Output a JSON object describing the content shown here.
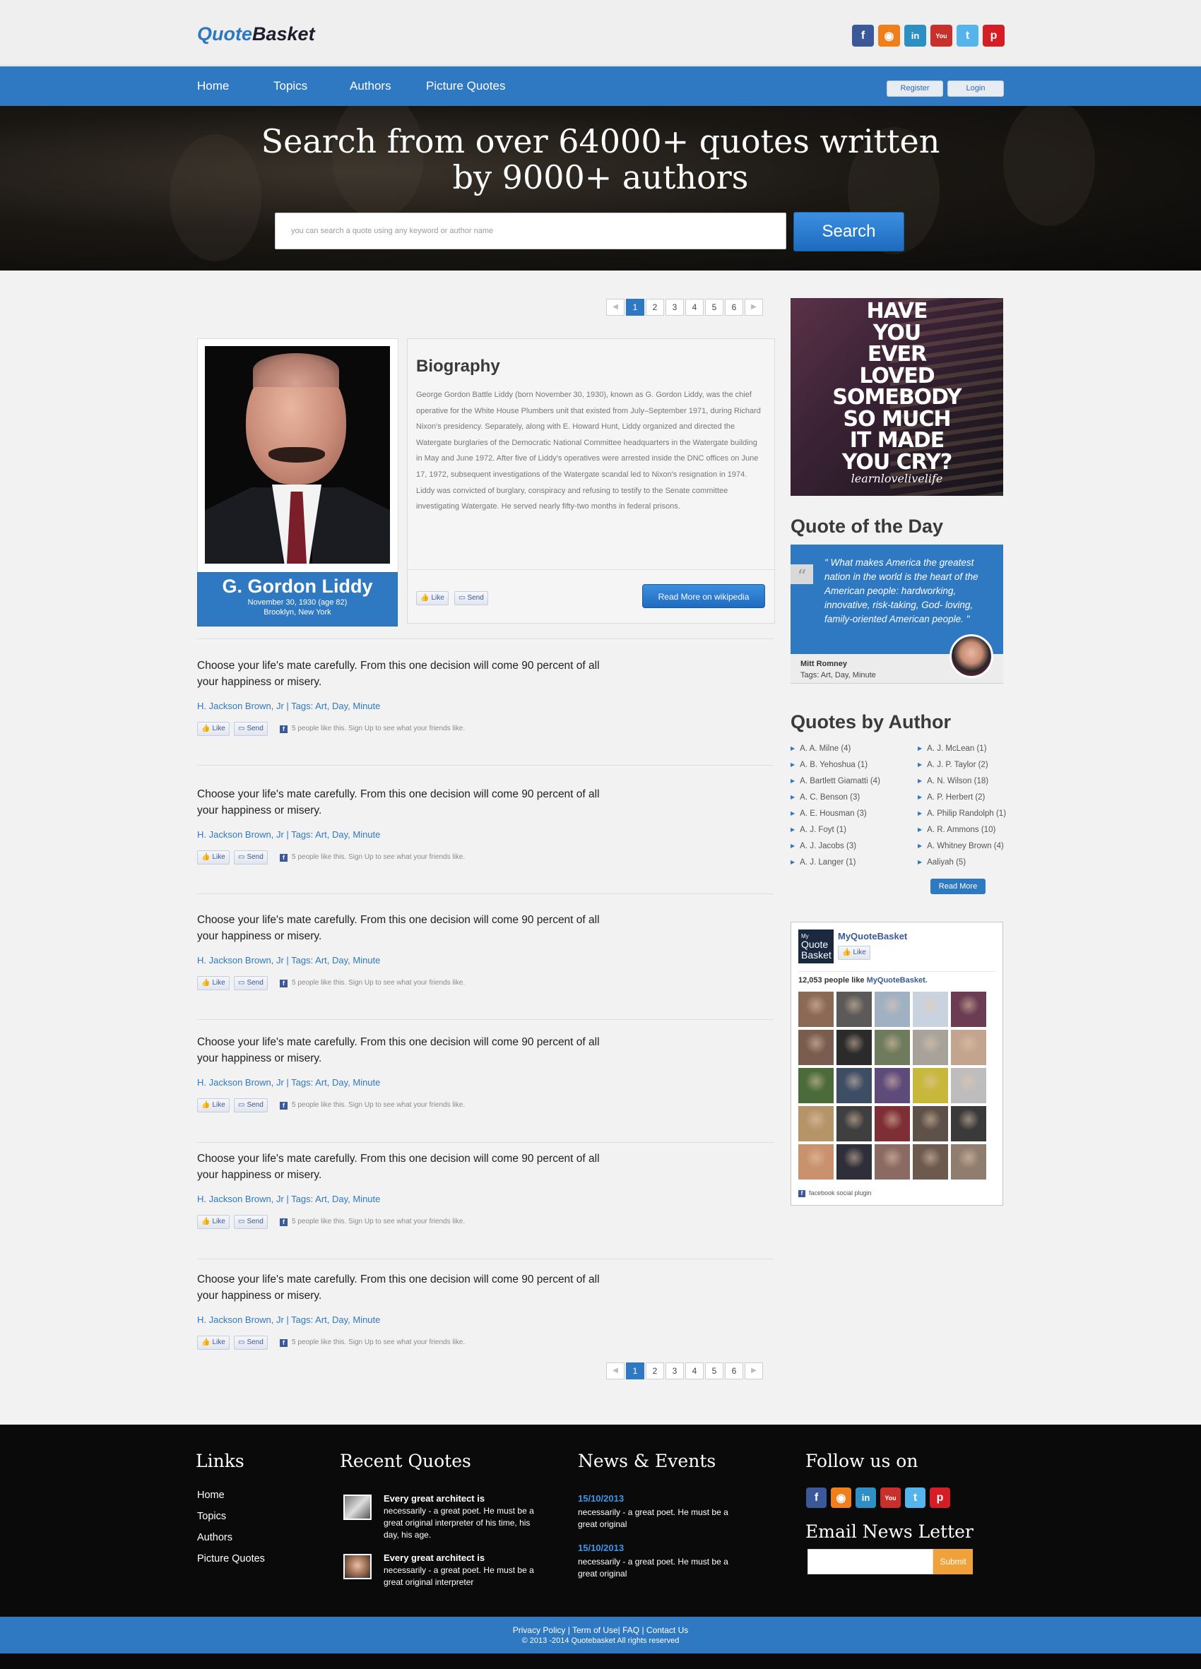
{
  "header": {
    "logo_part1": "Quote",
    "logo_part2": "Basket",
    "social": [
      {
        "icon": "facebook-icon",
        "glyph": "f"
      },
      {
        "icon": "rss-icon",
        "glyph": "◉"
      },
      {
        "icon": "linkedin-icon",
        "glyph": "in"
      },
      {
        "icon": "youtube-icon",
        "glyph": "You"
      },
      {
        "icon": "twitter-icon",
        "glyph": "t"
      },
      {
        "icon": "pinterest-icon",
        "glyph": "p"
      }
    ]
  },
  "nav": {
    "items": [
      "Home",
      "Topics",
      "Authors",
      "Picture Quotes"
    ],
    "register": "Register",
    "login": "Login"
  },
  "hero": {
    "title_line1": "Search from over 64000+ quotes written",
    "title_line2": "by 9000+ authors",
    "search_placeholder": "you can search a quote using any keyword or author name",
    "search_button": "Search"
  },
  "pagination": {
    "prev": "◀",
    "next": "▶",
    "pages": [
      "1",
      "2",
      "3",
      "4",
      "5",
      "6"
    ],
    "active": "1"
  },
  "author": {
    "name": "G. Gordon Liddy",
    "born": "November 30, 1930 (age 82)",
    "place": "Brooklyn, New York",
    "bio_title": "Biography",
    "bio": "George Gordon Battle Liddy (born November 30, 1930), known as G. Gordon Liddy, was the chief operative for the White House Plumbers unit that existed from July–September 1971, during Richard Nixon's presidency. Separately, along with E. Howard Hunt, Liddy organized and directed the Watergate burglaries of the Democratic National Committee headquarters in the Watergate building in May and June 1972. After five of Liddy's operatives were arrested inside the DNC offices on June 17, 1972, subsequent investigations of the Watergate scandal led to Nixon's resignation in 1974. Liddy was convicted of burglary, conspiracy and refusing to testify to the Senate committee investigating Watergate. He served nearly fifty-two months in federal prisons.",
    "read_more": "Read More on wikipedia",
    "like_label": "Like",
    "send_label": "Send"
  },
  "quotes": [
    {
      "text": "Choose your life's mate carefully. From this one decision will come 90 percent of all your happiness or misery.",
      "meta": "H. Jackson Brown, Jr | Tags: Art, Day, Minute",
      "like": "Like",
      "send": "Send",
      "fb": "5 people like this. Sign Up to see what your friends like."
    },
    {
      "text": "Choose your life's mate carefully. From this one decision will come 90 percent of all your happiness or misery.",
      "meta": "H. Jackson Brown, Jr | Tags: Art, Day, Minute",
      "like": "Like",
      "send": "Send",
      "fb": "5 people like this. Sign Up to see what your friends like."
    },
    {
      "text": "Choose your life's mate carefully. From this one decision will come 90 percent of all your happiness or misery.",
      "meta": "H. Jackson Brown, Jr | Tags: Art, Day, Minute",
      "like": "Like",
      "send": "Send",
      "fb": "5 people like this. Sign Up to see what your friends like."
    },
    {
      "text": "Choose your life's mate carefully. From this one decision will come 90 percent of all your happiness or misery.",
      "meta": "H. Jackson Brown, Jr | Tags: Art, Day, Minute",
      "like": "Like",
      "send": "Send",
      "fb": "5 people like this. Sign Up to see what your friends like."
    },
    {
      "text": "Choose your life's mate carefully. From this one decision will come 90 percent of all your happiness or misery.",
      "meta": "H. Jackson Brown, Jr | Tags: Art, Day, Minute",
      "like": "Like",
      "send": "Send",
      "fb": "5 people like this. Sign Up to see what your friends like."
    },
    {
      "text": "Choose your life's mate carefully. From this one decision will come 90 percent of all your happiness or misery.",
      "meta": "H. Jackson Brown, Jr | Tags: Art, Day, Minute",
      "like": "Like",
      "send": "Send",
      "fb": "5 people like this. Sign Up to see what your friends like."
    }
  ],
  "sidebar": {
    "ad_lines": [
      "HAVE",
      "YOU",
      "EVER",
      "LOVED",
      "SOMEBODY",
      "SO MUCH",
      "IT MADE",
      "YOU CRY?"
    ],
    "ad_signature": "learnlovelivelife",
    "qotd_title": "Quote of the Day",
    "qotd_mark": "“",
    "qotd_text": "\" What makes America the greatest nation in the world is the heart of the American people: hardworking, innovative, risk-taking, God- loving, family-oriented American people. \"",
    "qotd_author": "Mitt Romney",
    "qotd_tags_label": "Tags:",
    "qotd_tags": "Art, Day, Minute",
    "qba_title": "Quotes by Author",
    "qba_col1": [
      "A. A. Milne (4)",
      "A. B. Yehoshua (1)",
      "A. Bartlett Giamatti (4)",
      "A. C. Benson (3)",
      "A. E. Housman (3)",
      "A. J. Foyt (1)",
      "A. J. Jacobs (3)",
      "A. J. Langer (1)"
    ],
    "qba_col2": [
      "A. J. McLean (1)",
      "A. J. P. Taylor (2)",
      "A. N. Wilson (18)",
      "A. P. Herbert (2)",
      "A. Philip Randolph (1)",
      "A. R. Ammons (10)",
      "A. Whitney Brown (4)",
      "Aaliyah (5)"
    ],
    "read_more": "Read More",
    "fb_logo_1": "My",
    "fb_logo_2": "Quote",
    "fb_logo_3": "Basket",
    "fb_page": "MyQuoteBasket",
    "fb_like": "Like",
    "fb_count": "12,053 people like ",
    "fb_count_page": "MyQuoteBasket.",
    "fb_plugin": "facebook social plugin"
  },
  "footer": {
    "links_title": "Links",
    "links": [
      "Home",
      "Topics",
      "Authors",
      "Picture Quotes"
    ],
    "recent_title": "Recent Quotes",
    "recent": [
      {
        "title": "Every great architect is",
        "text": "necessarily - a great poet. He must be a great original interpreter of his time, his day, his age."
      },
      {
        "title": "Every great architect is",
        "text": "necessarily - a great poet. He must be a great original interpreter"
      }
    ],
    "news_title": "News & Events",
    "news": [
      {
        "date": "15/10/2013",
        "text": "necessarily - a great poet. He must be a great original"
      },
      {
        "date": "15/10/2013",
        "text": "necessarily - a great poet. He must be a great original"
      }
    ],
    "follow_title": "Follow us on",
    "newsletter_title": "Email News Letter",
    "submit": "Submit",
    "bottom_links": "Privacy Policy | Term of Use| FAQ | Contact Us",
    "copyright": "© 2013 -2014 Quotebasket All rights reserved"
  }
}
